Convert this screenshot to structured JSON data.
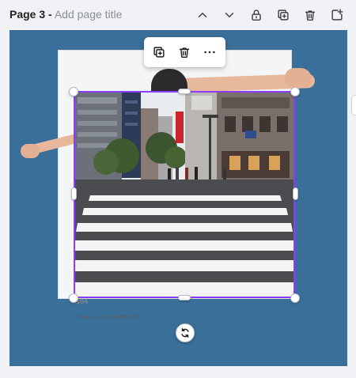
{
  "header": {
    "page_label": "Page 3 -",
    "title_placeholder": "Add page title",
    "icons": [
      "chevron-up-icon",
      "chevron-down-icon",
      "lock-icon",
      "duplicate-page-icon",
      "trash-icon",
      "add-page-icon"
    ]
  },
  "canvas": {
    "background": "#3a6f99",
    "post": {
      "count": "104",
      "comments_link": "Show all comments (17)"
    }
  },
  "selection": {
    "color": "#8b3dff",
    "toolbar_icons": [
      "duplicate-icon",
      "trash-icon",
      "more-icon"
    ],
    "rotate_icon": "rotate-icon"
  }
}
